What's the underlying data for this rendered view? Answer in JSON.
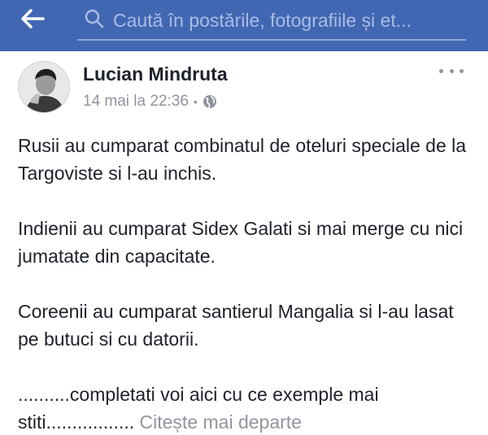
{
  "topbar": {
    "back_icon": "back-arrow-icon",
    "search": {
      "icon": "search-icon",
      "placeholder": "Caută în postările, fotografiile și et..."
    }
  },
  "post": {
    "author": "Lucian Mindruta",
    "timestamp": "14 mai la 22:36",
    "separator": "•",
    "privacy_icon": "globe-icon",
    "more_icon": "more-options-icon",
    "paragraphs": [
      "Rusii au cumparat combinatul de oteluri speciale de la Targoviste si l-au inchis.",
      "Indienii au cumparat Sidex Galati si mai merge cu nici jumatate din capacitate.",
      "Coreenii au cumparat santierul Mangalia si l-au lasat pe butuci si cu datorii."
    ],
    "last_paragraph": "..........completati voi aici cu ce exemple mai stiti.................",
    "see_more": "Citește mai departe"
  },
  "colors": {
    "topbar_bg": "#4267b2",
    "name_text": "#1d2129",
    "meta_text": "#90949c"
  }
}
